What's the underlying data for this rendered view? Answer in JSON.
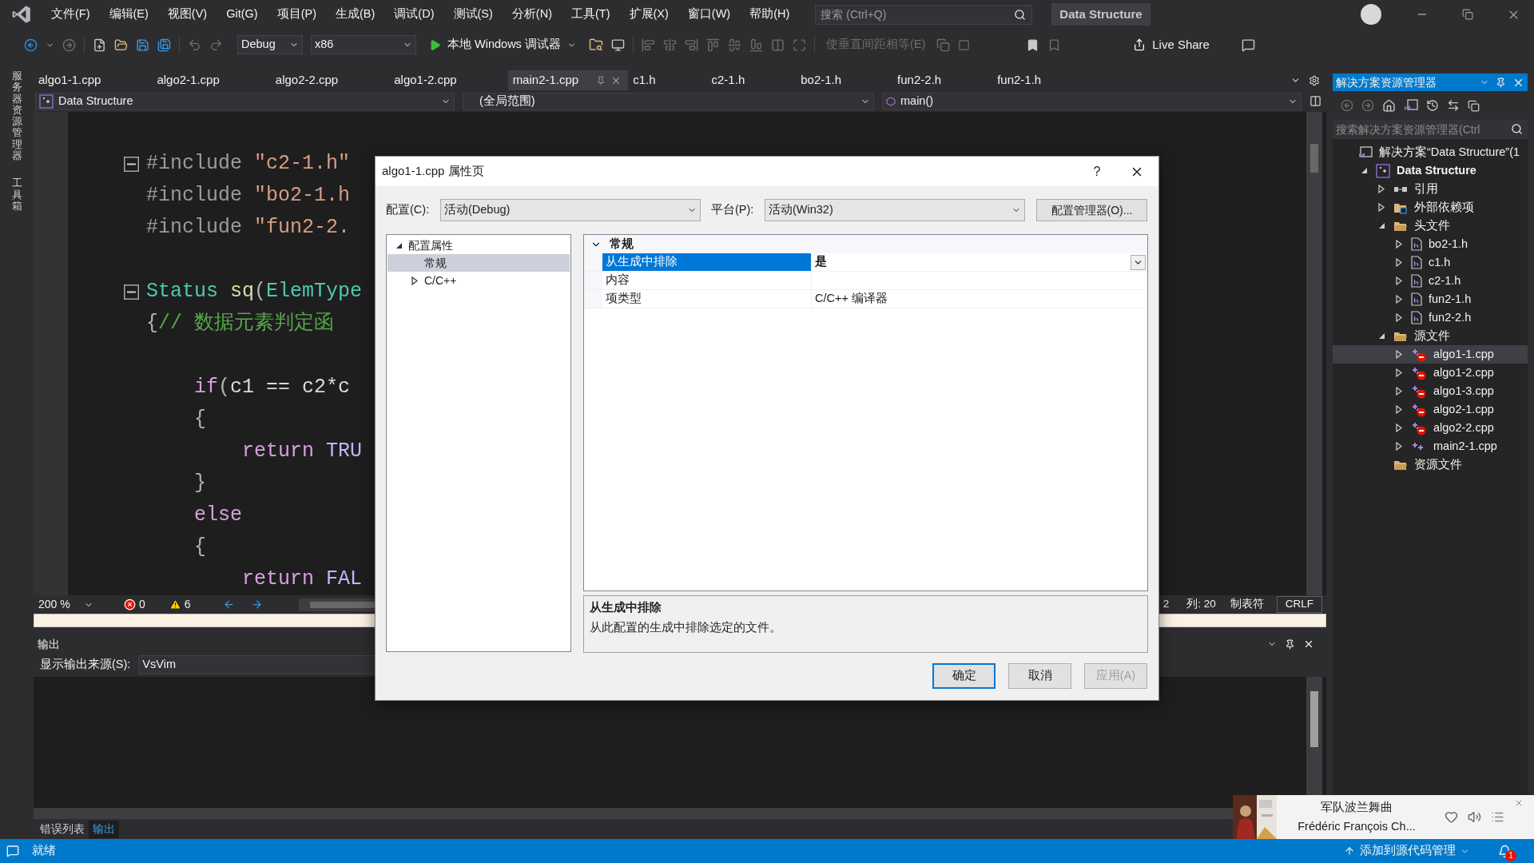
{
  "menu_bar": {
    "items": [
      "文件(F)",
      "编辑(E)",
      "视图(V)",
      "Git(G)",
      "项目(P)",
      "生成(B)",
      "调试(D)",
      "测试(S)",
      "分析(N)",
      "工具(T)",
      "扩展(X)",
      "窗口(W)",
      "帮助(H)"
    ],
    "search": {
      "placeholder": "搜索 (Ctrl+Q)"
    },
    "solution_name": "Data Structure"
  },
  "toolbar": {
    "configuration": "Debug",
    "platform": "x86",
    "run_button": "本地 Windows 调试器",
    "equal_spacing": {
      "label": "使垂直间距相等(E)",
      "disabled": true
    },
    "live_share": "Live Share"
  },
  "side_tabs": [
    "服务器资源管理器",
    "工具箱"
  ],
  "document_tabs": [
    {
      "label": "algo1-1.cpp",
      "selected": false
    },
    {
      "label": "algo2-1.cpp",
      "selected": false
    },
    {
      "label": "algo2-2.cpp",
      "selected": false
    },
    {
      "label": "algo1-2.cpp",
      "selected": false
    },
    {
      "label": "main2-1.cpp",
      "selected": true
    },
    {
      "label": "c1.h",
      "selected": false
    },
    {
      "label": "c2-1.h",
      "selected": false
    },
    {
      "label": "bo2-1.h",
      "selected": false
    },
    {
      "label": "fun2-2.h",
      "selected": false
    },
    {
      "label": "fun2-1.h",
      "selected": false
    }
  ],
  "nav_bar": {
    "project": "Data Structure",
    "scope": "(全局范围)",
    "member": "main()"
  },
  "code_blocks": [
    [
      {
        "fold": true,
        "tokens": [
          {
            "text": "#include ",
            "kind": "directive"
          },
          {
            "text": "\"c2-1.h\"",
            "kind": "string"
          }
        ]
      },
      {
        "fold": false,
        "tokens": [
          {
            "text": "#include ",
            "kind": "directive"
          },
          {
            "text": "\"bo2-1.h",
            "kind": "string"
          }
        ]
      },
      {
        "fold": false,
        "tokens": [
          {
            "text": "#include ",
            "kind": "directive"
          },
          {
            "text": "\"fun2-2.",
            "kind": "string"
          }
        ]
      }
    ],
    [
      {
        "fold": true,
        "tokens": [
          {
            "text": "Status ",
            "kind": "type"
          },
          {
            "text": "sq",
            "kind": "function"
          },
          {
            "text": "(",
            "kind": "punct"
          },
          {
            "text": "ElemType",
            "kind": "type"
          }
        ]
      },
      {
        "fold": false,
        "tokens": [
          {
            "text": "{",
            "kind": "punct"
          },
          {
            "text": "// 数据元素判定函",
            "kind": "comment"
          }
        ]
      }
    ],
    [
      {
        "fold": false,
        "tokens": [
          {
            "text": "    if",
            "kind": "keyword"
          },
          {
            "text": "(",
            "kind": "punct"
          },
          {
            "text": "c1 == c2*c",
            "kind": "plain"
          }
        ]
      },
      {
        "fold": false,
        "tokens": [
          {
            "text": "    {",
            "kind": "punct"
          }
        ]
      },
      {
        "fold": false,
        "tokens": [
          {
            "text": "        return ",
            "kind": "keyword"
          },
          {
            "text": "TRU",
            "kind": "macro"
          }
        ]
      },
      {
        "fold": false,
        "tokens": [
          {
            "text": "    }",
            "kind": "punct"
          }
        ]
      },
      {
        "fold": false,
        "tokens": [
          {
            "text": "    else",
            "kind": "keyword"
          }
        ]
      },
      {
        "fold": false,
        "tokens": [
          {
            "text": "    {",
            "kind": "punct"
          }
        ]
      },
      {
        "fold": false,
        "tokens": [
          {
            "text": "        return ",
            "kind": "keyword"
          },
          {
            "text": "FAL",
            "kind": "macro"
          }
        ]
      }
    ]
  ],
  "editor_status": {
    "zoom": "200 %",
    "errors": "0",
    "warnings": "6",
    "line": "2",
    "column": "列: 20",
    "indent": "制表符",
    "line_ending": "CRLF"
  },
  "output_panel": {
    "title": "输出",
    "source_label": "显示输出来源(S):",
    "source": "VsVim"
  },
  "bottom_tabs": [
    {
      "label": "错误列表",
      "selected": false
    },
    {
      "label": "输出",
      "selected": true
    }
  ],
  "status_bar": {
    "message": "就绪",
    "source_control": "添加到源代码管理",
    "notifications": "1"
  },
  "solution_explorer": {
    "title": "解决方案资源管理器",
    "search": {
      "placeholder": "搜索解决方案资源管理器(Ctrl"
    },
    "tree": [
      {
        "label": "解决方案“Data Structure”(1",
        "kind": "solution",
        "selected": false,
        "children": [
          {
            "label": "Data Structure",
            "kind": "project",
            "expanded": true,
            "selected": false,
            "children": [
              {
                "label": "引用",
                "kind": "references",
                "expanded": false,
                "selected": false
              },
              {
                "label": "外部依赖项",
                "kind": "dependencies",
                "expanded": false,
                "selected": false
              },
              {
                "label": "头文件",
                "kind": "folder",
                "expanded": true,
                "selected": false,
                "children": [
                  {
                    "label": "bo2-1.h",
                    "kind": "header",
                    "expanded": false,
                    "selected": false
                  },
                  {
                    "label": "c1.h",
                    "kind": "header",
                    "expanded": false,
                    "selected": false
                  },
                  {
                    "label": "c2-1.h",
                    "kind": "header",
                    "expanded": false,
                    "selected": false
                  },
                  {
                    "label": "fun2-1.h",
                    "kind": "header",
                    "expanded": false,
                    "selected": false
                  },
                  {
                    "label": "fun2-2.h",
                    "kind": "header",
                    "expanded": false,
                    "selected": false
                  }
                ]
              },
              {
                "label": "源文件",
                "kind": "folder",
                "expanded": true,
                "selected": false,
                "children": [
                  {
                    "label": "algo1-1.cpp",
                    "kind": "source",
                    "excluded": true,
                    "expanded": false,
                    "selected": true
                  },
                  {
                    "label": "algo1-2.cpp",
                    "kind": "source",
                    "excluded": true,
                    "expanded": false,
                    "selected": false
                  },
                  {
                    "label": "algo1-3.cpp",
                    "kind": "source",
                    "excluded": true,
                    "expanded": false,
                    "selected": false
                  },
                  {
                    "label": "algo2-1.cpp",
                    "kind": "source",
                    "excluded": true,
                    "expanded": false,
                    "selected": false
                  },
                  {
                    "label": "algo2-2.cpp",
                    "kind": "source",
                    "excluded": true,
                    "expanded": false,
                    "selected": false
                  },
                  {
                    "label": "main2-1.cpp",
                    "kind": "source",
                    "excluded": false,
                    "expanded": false,
                    "selected": false
                  }
                ]
              },
              {
                "label": "资源文件",
                "kind": "folder",
                "selected": false
              }
            ]
          }
        ]
      }
    ]
  },
  "dialog": {
    "title": "algo1-1.cpp 属性页",
    "help": "?",
    "configuration_label": "配置(C):",
    "configuration": "活动(Debug)",
    "platform_label": "平台(P):",
    "platform": "活动(Win32)",
    "config_manager_button": "配置管理器(O)...",
    "tree": [
      {
        "label": "配置属性",
        "expanded": true,
        "selected": false,
        "children": [
          {
            "label": "常规",
            "selected": true
          },
          {
            "label": "C/C++",
            "expanded": false,
            "selected": false
          }
        ]
      }
    ],
    "property_grid": {
      "category": "常规",
      "expanded": true,
      "rows": [
        {
          "name": "从生成中排除",
          "value": "是",
          "selected": true
        },
        {
          "name": "内容",
          "selected": false
        },
        {
          "name": "项类型",
          "value": "C/C++ 编译器",
          "selected": false
        }
      ]
    },
    "description": {
      "title": "从生成中排除",
      "text": "从此配置的生成中排除选定的文件。"
    },
    "buttons": [
      {
        "label": "确定",
        "default": true,
        "disabled": false
      },
      {
        "label": "取消",
        "default": false,
        "disabled": false
      },
      {
        "label": "应用(A)",
        "default": false,
        "disabled": true
      }
    ]
  },
  "media_toast": {
    "title": "军队波兰舞曲",
    "artist": "Frédéric François Ch..."
  }
}
